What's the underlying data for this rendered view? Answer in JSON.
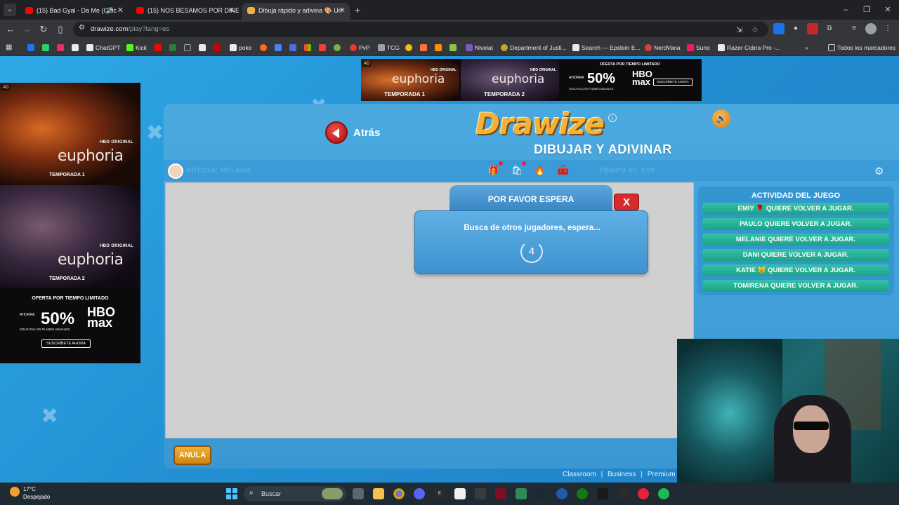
{
  "browser": {
    "tabs": [
      {
        "title": "(15) Bad Gyal - Da Me (Offic",
        "favicon_color": "#ff0000",
        "audio": true,
        "active": false
      },
      {
        "title": "(15) NOS BESAMOS POR DINE",
        "favicon_color": "#ff0000",
        "audio": false,
        "active": false
      },
      {
        "title": "Dibuja rápido y adivina 🎨 Un",
        "favicon_color": "#f4b13a",
        "audio": false,
        "active": true
      }
    ],
    "url_host": "drawize.com",
    "url_path": "/play?lang=es",
    "bookmarks": [
      {
        "label": "",
        "color": "#1877f2"
      },
      {
        "label": "",
        "color": "#25d366"
      },
      {
        "label": "",
        "color": "#e1306c"
      },
      {
        "label": "",
        "color": "#e8eaed"
      },
      {
        "label": "ChatGPT",
        "color": "#e8eaed"
      },
      {
        "label": "Kick",
        "color": "#53fc18"
      },
      {
        "label": "",
        "color": "#ff0000"
      },
      {
        "label": "",
        "color": "#2e7d32"
      },
      {
        "label": "",
        "color": "#e8eaed"
      },
      {
        "label": "",
        "color": "#cc0000"
      },
      {
        "label": "poke",
        "color": "#e8eaed"
      },
      {
        "label": "",
        "color": "#ff6b1a"
      },
      {
        "label": "",
        "color": "#4285f4"
      },
      {
        "label": "",
        "color": "#4a6ee0"
      },
      {
        "label": "",
        "color": "#34a853"
      },
      {
        "label": "",
        "color": "#ea4335"
      },
      {
        "label": "",
        "color": "#7cb342"
      },
      {
        "label": "PvP",
        "color": "#e53935"
      },
      {
        "label": "TCG",
        "color": "#9aa0a6"
      },
      {
        "label": "",
        "color": "#fbbc05"
      },
      {
        "label": "",
        "color": "#ff7043"
      },
      {
        "label": "",
        "color": "#ff8f00"
      },
      {
        "label": "",
        "color": "#8bc34a"
      },
      {
        "label": "Nivelat",
        "color": "#7e57c2"
      },
      {
        "label": "Department of Justi...",
        "color": "#c9a227"
      },
      {
        "label": "Search — Epstein E...",
        "color": "#e8eaed"
      },
      {
        "label": "NerdVana",
        "color": "#e53935"
      },
      {
        "label": "Suno",
        "color": "#e91e63"
      },
      {
        "label": "Razer Cobra Pro -...",
        "color": "#e8eaed"
      }
    ],
    "all_bookmarks_label": "Todos los marcadores"
  },
  "ads": {
    "ad_tag": "AD",
    "hbo_original": "HBO ORIGINAL",
    "show_name": "euphoria",
    "season1": "TEMPORADA 1",
    "season2": "TEMPORADA 2",
    "offer_text": "OFERTA POR TIEMPO LIMITADO",
    "offer_now": "AHORRA",
    "offer_percent": "50%",
    "offer_brand": "HBO max",
    "offer_plans": "SOLO EN LOS PLANES ANUALES",
    "offer_cta": "SUSCRÍBETE AHORA"
  },
  "game": {
    "back_label": "Atrás",
    "logo": "Drawize",
    "logo_subtitle": "DIBUJAR Y ADIVINAR",
    "artist_label": "ARTISTA: MELANIE",
    "time_label": "TIEMPO X5: 0:00",
    "activity_title": "ACTIVIDAD DEL JUEGO",
    "activity_rows": [
      "EMIY 🌹 QUIERE VOLVER A JUGAR.",
      "PAULO QUIERE VOLVER A JUGAR.",
      "MELANIE QUIERE VOLVER A JUGAR.",
      "DANI QUIERE VOLVER A JUGAR.",
      "KATIE 😸 QUIERE VOLVER A JUGAR.",
      "TOMIRENA QUIERE VOLVER A JUGAR."
    ],
    "cancel_label": "ANULA",
    "footer_links": [
      "Classroom",
      "|",
      "Business",
      "|",
      "Premium",
      "|"
    ]
  },
  "dialog": {
    "title": "POR FAVOR ESPERA",
    "close_label": "X",
    "message": "Busca de otros jugadores, espera...",
    "countdown": "4"
  },
  "taskbar": {
    "temperature": "17°C",
    "weather": "Despejado",
    "search_label": "Buscar"
  },
  "colors": {
    "page_bg": "#2390d4",
    "activity_row": "#1ea08a",
    "close_red": "#d62b2b",
    "cancel_orange": "#e09a20"
  }
}
